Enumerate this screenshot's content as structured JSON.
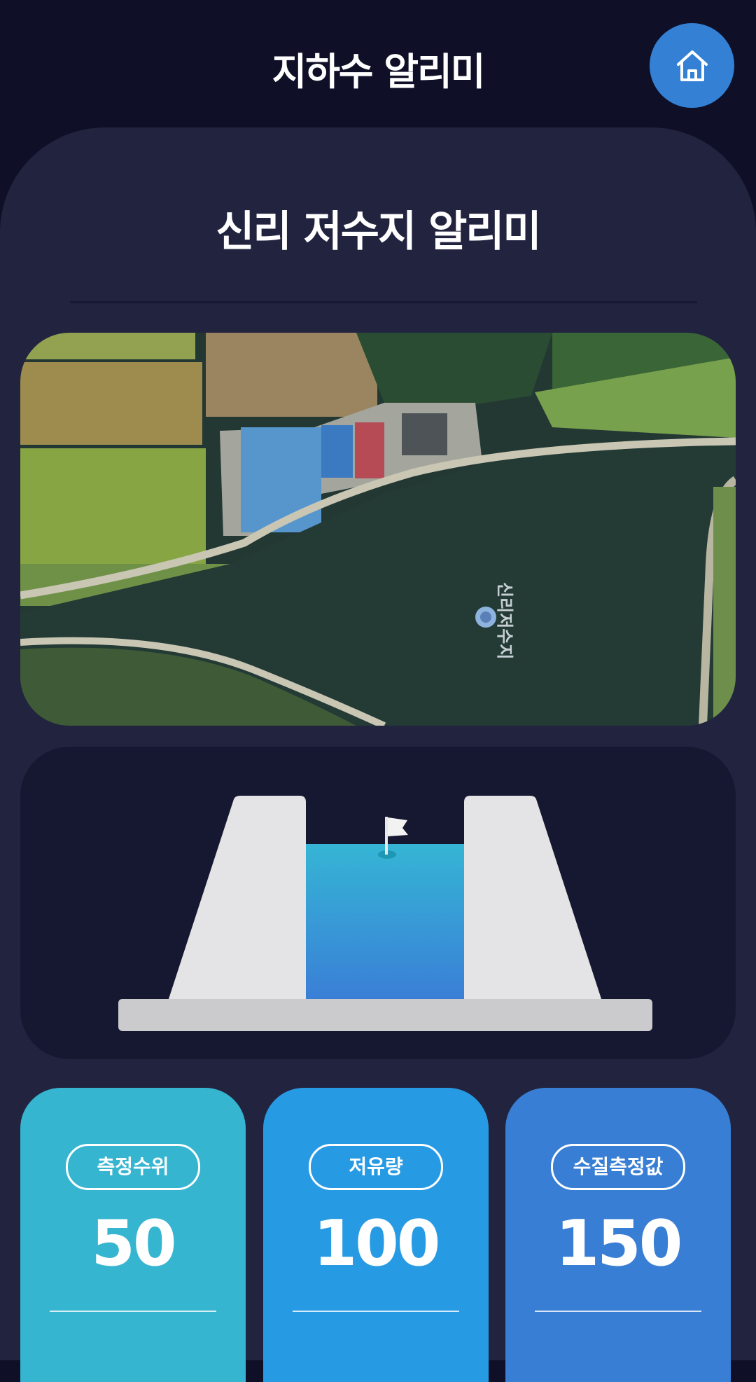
{
  "header": {
    "title": "지하수 알리미",
    "home_icon": "home-icon"
  },
  "reservoir": {
    "title": "신리 저수지 알리미",
    "map_label": "신리저수지"
  },
  "gauge": {
    "flag_icon": "flag-icon"
  },
  "stats": [
    {
      "label": "측정수위",
      "value": "50",
      "color": "#35b5d0"
    },
    {
      "label": "저유량",
      "value": "100",
      "color": "#279ae4"
    },
    {
      "label": "수질측정값",
      "value": "150",
      "color": "#377ed4"
    }
  ],
  "colors": {
    "background": "#0f1027",
    "panel": "#22243f",
    "accent": "#3380d4",
    "water_top": "#35b5d5",
    "water_bottom": "#3a7fd6"
  }
}
